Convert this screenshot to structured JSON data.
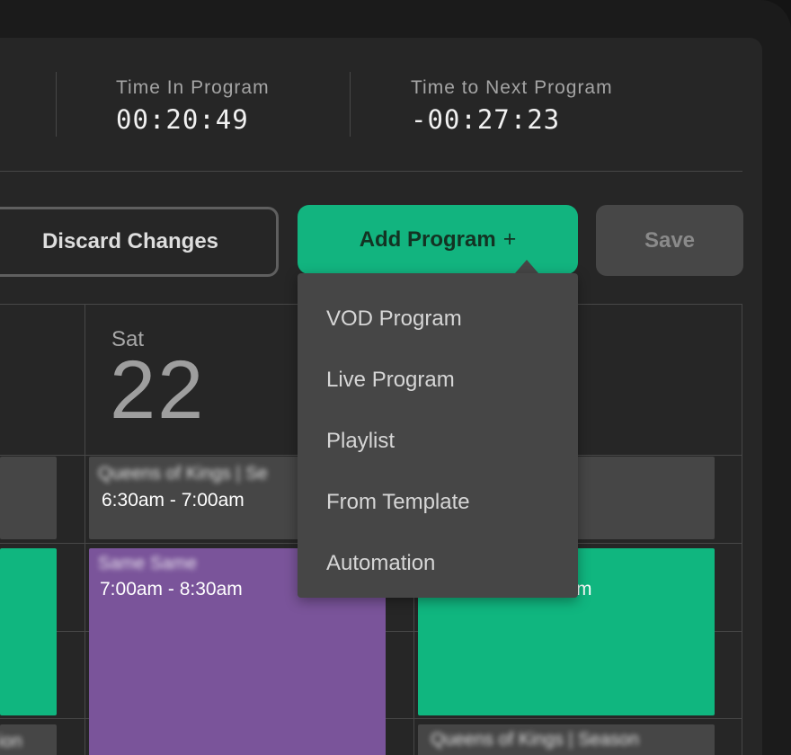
{
  "stats": {
    "time_in_program_label": "Time In Program",
    "time_in_program_value": "00:20:49",
    "time_to_next_label": "Time to Next Program",
    "time_to_next_value": "-00:27:23"
  },
  "toolbar": {
    "discard_label": "Discard Changes",
    "add_label": "Add Program",
    "add_icon": "+",
    "save_label": "Save"
  },
  "menu": {
    "items": [
      "VOD Program",
      "Live Program",
      "Playlist",
      "From Template",
      "Automation"
    ]
  },
  "calendar": {
    "day_name": "Sat",
    "day_number": "22",
    "events": [
      {
        "title": "Queens of Kings | Se",
        "time": "6:30am - 7:00am"
      },
      {
        "title": "Same Same",
        "time": "7:00am - 8:30am"
      },
      {
        "title": "",
        "time": "m"
      },
      {
        "title": "Queens of Kings | Season",
        "time": ""
      },
      {
        "title": "ion",
        "time": ""
      }
    ]
  },
  "colors": {
    "accent_green": "#12b47f",
    "purple_event": "#7a549a",
    "gray_event": "#464646",
    "panel": "#262626"
  }
}
